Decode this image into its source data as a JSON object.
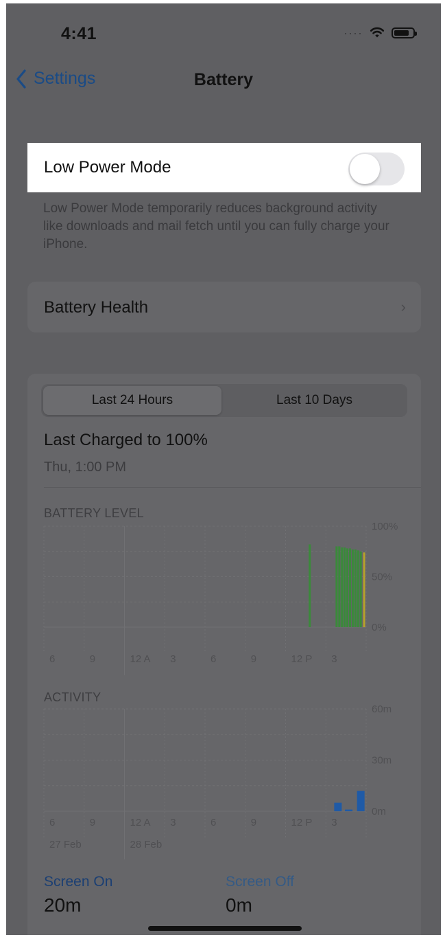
{
  "status_bar": {
    "time": "4:41"
  },
  "nav": {
    "back_label": "Settings",
    "title": "Battery"
  },
  "low_power": {
    "label": "Low Power Mode",
    "enabled": false,
    "description": "Low Power Mode temporarily reduces background activity like downloads and mail fetch until you can fully charge your iPhone."
  },
  "battery_health": {
    "label": "Battery Health"
  },
  "usage": {
    "tabs": [
      "Last 24 Hours",
      "Last 10 Days"
    ],
    "selected_tab": 0,
    "last_charged": {
      "title": "Last Charged to 100%",
      "subtitle": "Thu, 1:00 PM"
    }
  },
  "chart_data": [
    {
      "type": "bar",
      "title": "BATTERY LEVEL",
      "x_tick_labels": [
        "6",
        "9",
        "12 A",
        "3",
        "6",
        "9",
        "12 P",
        "3"
      ],
      "y_tick_labels": [
        "100%",
        "50%",
        "0%"
      ],
      "ylim": [
        0,
        100
      ],
      "hours": 24,
      "series": [
        {
          "color": "#3a8a3a",
          "bars": [
            {
              "hour": 19.8,
              "value": 82
            },
            {
              "hour": 21.8,
              "value": 80
            },
            {
              "hour": 22.0,
              "value": 80
            },
            {
              "hour": 22.2,
              "value": 79
            },
            {
              "hour": 22.4,
              "value": 79
            },
            {
              "hour": 22.6,
              "value": 78
            },
            {
              "hour": 22.8,
              "value": 78
            },
            {
              "hour": 23.0,
              "value": 77
            },
            {
              "hour": 23.2,
              "value": 77
            },
            {
              "hour": 23.4,
              "value": 76
            },
            {
              "hour": 23.6,
              "value": 75
            }
          ]
        },
        {
          "color": "#b8a12a",
          "bars": [
            {
              "hour": 23.85,
              "value": 74
            }
          ]
        }
      ]
    },
    {
      "type": "bar",
      "title": "ACTIVITY",
      "x_tick_labels": [
        "6",
        "9",
        "12 A",
        "3",
        "6",
        "9",
        "12 P",
        "3"
      ],
      "date_labels": [
        "27 Feb",
        "28 Feb"
      ],
      "y_tick_labels": [
        "60m",
        "30m",
        "0m"
      ],
      "ylim": [
        0,
        60
      ],
      "hours": 24,
      "series": [
        {
          "name": "Screen On",
          "color": "#1f5aa6",
          "bars": [
            {
              "hour": 21.9,
              "value": 5
            },
            {
              "hour": 22.7,
              "value": 1
            },
            {
              "hour": 23.6,
              "value": 12
            }
          ]
        }
      ]
    }
  ],
  "legend": {
    "screen_on": {
      "label": "Screen On",
      "value": "20m"
    },
    "screen_off": {
      "label": "Screen Off",
      "value": "0m"
    }
  }
}
